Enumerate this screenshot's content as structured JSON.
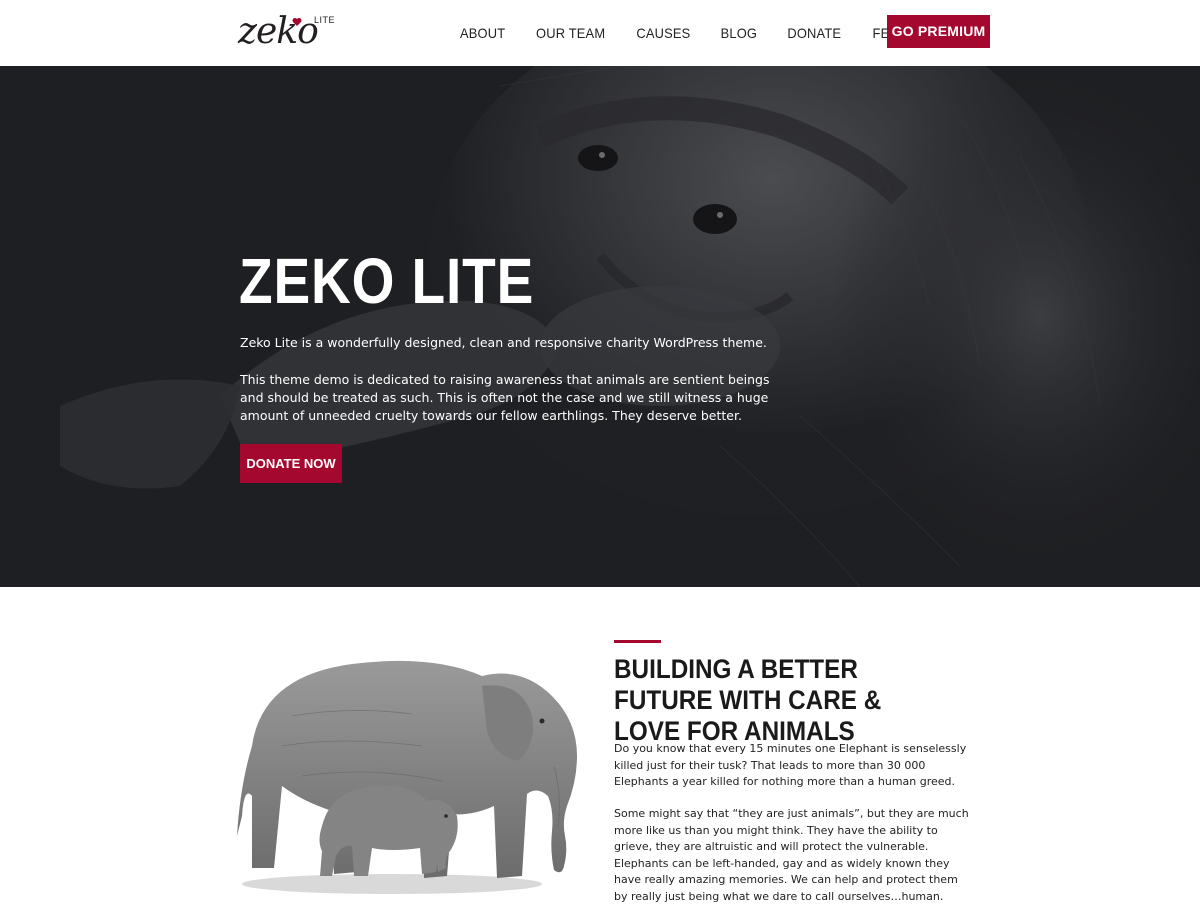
{
  "header": {
    "logo_text": "zeko",
    "logo_sup": "LITE",
    "nav": [
      {
        "label": "ABOUT"
      },
      {
        "label": "OUR TEAM"
      },
      {
        "label": "CAUSES"
      },
      {
        "label": "BLOG"
      },
      {
        "label": "DONATE"
      },
      {
        "label": "FEATURES",
        "icon": "chevron-down-icon"
      }
    ],
    "cta_label": "GO PREMIUM"
  },
  "hero": {
    "title": "ZEKO LITE",
    "intro": "Zeko Lite is a wonderfully designed, clean and responsive charity WordPress theme.",
    "description": "This theme demo is dedicated to raising awareness that animals are sentient beings and should be treated as such. This is often not the case and we still witness a huge amount of unneeded cruelty towards our fellow earthlings. They deserve better.",
    "button_label": "DONATE NOW"
  },
  "about": {
    "title": "BUILDING A BETTER FUTURE WITH CARE & LOVE FOR ANIMALS",
    "paragraphs": [
      "Do you know that every 15 minutes one Elephant is senselessly killed just for their tusk? That leads to more than 30 000 Elephants a year killed for nothing more than a human greed.",
      "Some might say that “they are just animals”, but they are much more like us than you might think. They have the ability to grieve, they are altruistic and will protect the vulnerable. Elephants can be left-handed, gay and as widely known they have really amazing memories. We can help and protect them by really just being what we dare to call ourselves…human."
    ]
  },
  "colors": {
    "accent": "#a5082f",
    "hero_background": "#1e1f22",
    "text_dark": "#222222"
  }
}
